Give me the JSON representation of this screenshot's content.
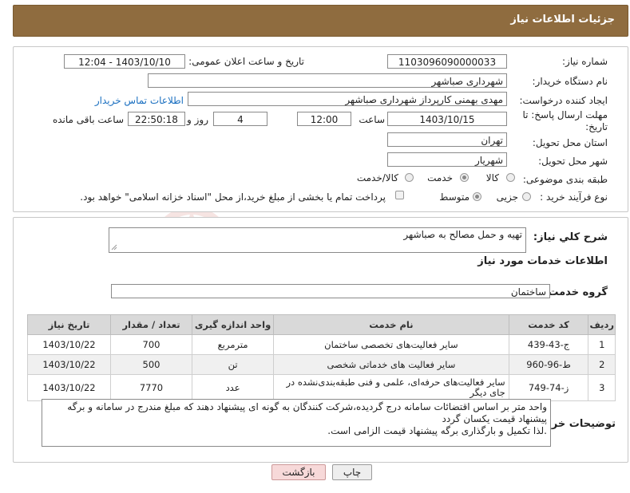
{
  "header": {
    "title": "جزئیات اطلاعات نیاز"
  },
  "form": {
    "need_number_label": "شماره نیاز:",
    "need_number": "1103096090000033",
    "announce_label": "تاریخ و ساعت اعلان عمومی:",
    "announce_value": "1403/10/10 - 12:04",
    "buyer_org_label": "نام دستگاه خریدار:",
    "buyer_org": "شهرداری صباشهر",
    "creator_label": "ایجاد کننده درخواست:",
    "creator": "مهدی بهمنی کارپرداز شهرداری صباشهر",
    "contact_link": "اطلاعات تماس خریدار",
    "deadline_label_1": "مهلت ارسال پاسخ: تا",
    "deadline_label_2": "تاریخ:",
    "deadline_date": "1403/10/15",
    "time_label": "ساعت",
    "deadline_time": "12:00",
    "days_value": "4",
    "days_label": "روز و",
    "remaining_time": "22:50:18",
    "remaining_label": "ساعت باقی مانده",
    "province_label": "استان محل تحویل:",
    "province": "تهران",
    "city_label": "شهر محل تحویل:",
    "city": "شهریار",
    "category_label": "طبقه بندی موضوعی:",
    "category_options": [
      "کالا",
      "خدمت",
      "کالا/خدمت"
    ],
    "category_selected": "خدمت",
    "process_label": "نوع فرآیند خرید :",
    "process_options": [
      "جزیی",
      "متوسط"
    ],
    "process_selected": "متوسط",
    "payment_note": "پرداخت تمام یا بخشی از مبلغ خرید،از محل \"اسناد خزانه اسلامی\" خواهد بود."
  },
  "summary": {
    "label": "شرح کلي نياز:",
    "value": "تهیه و حمل مصالح به صباشهر"
  },
  "services": {
    "section_title": "اطلاعات خدمات مورد نیاز",
    "group_label": "گروه خدمت:",
    "group_value": "ساختمان",
    "columns": [
      "ردیف",
      "کد خدمت",
      "نام خدمت",
      "واحد اندازه گیری",
      "تعداد / مقدار",
      "تاریخ نیاز"
    ],
    "rows": [
      {
        "row": "1",
        "code": "ج-43-439",
        "name": "سایر فعالیت‌های تخصصی ساختمان",
        "unit": "مترمربع",
        "qty": "700",
        "date": "1403/10/22"
      },
      {
        "row": "2",
        "code": "ط-96-960",
        "name": "سایر فعالیت های خدماتی شخصی",
        "unit": "تن",
        "qty": "500",
        "date": "1403/10/22"
      },
      {
        "row": "3",
        "code": "ز-74-749",
        "name": "سایر فعالیت‌های حرفه‌ای، علمی و فنی طبقه‌بندی‌نشده در جای دیگر",
        "unit": "عدد",
        "qty": "7770",
        "date": "1403/10/22"
      }
    ]
  },
  "buyer_notes": {
    "label": "توضیحات خریدار:",
    "line1": "واحد متر بر اساس اقتضائات سامانه درج گردیده،شرکت کنندگان به گونه ای پیشنهاد دهند که مبلغ مندرج در سامانه و برگه پیشنهاد قیمت یکسان گردد",
    "line2": ".لذا تکمیل و بارگذاری برگه پیشنهاد قیمت الزامی است."
  },
  "buttons": {
    "print": "چاپ",
    "back": "بازگشت"
  },
  "watermark": {
    "text": "AriaTender.neT"
  },
  "colors": {
    "header_bg": "#8f6c3f",
    "link": "#1a6fc0",
    "back_button_bg": "#f7d9d9"
  }
}
